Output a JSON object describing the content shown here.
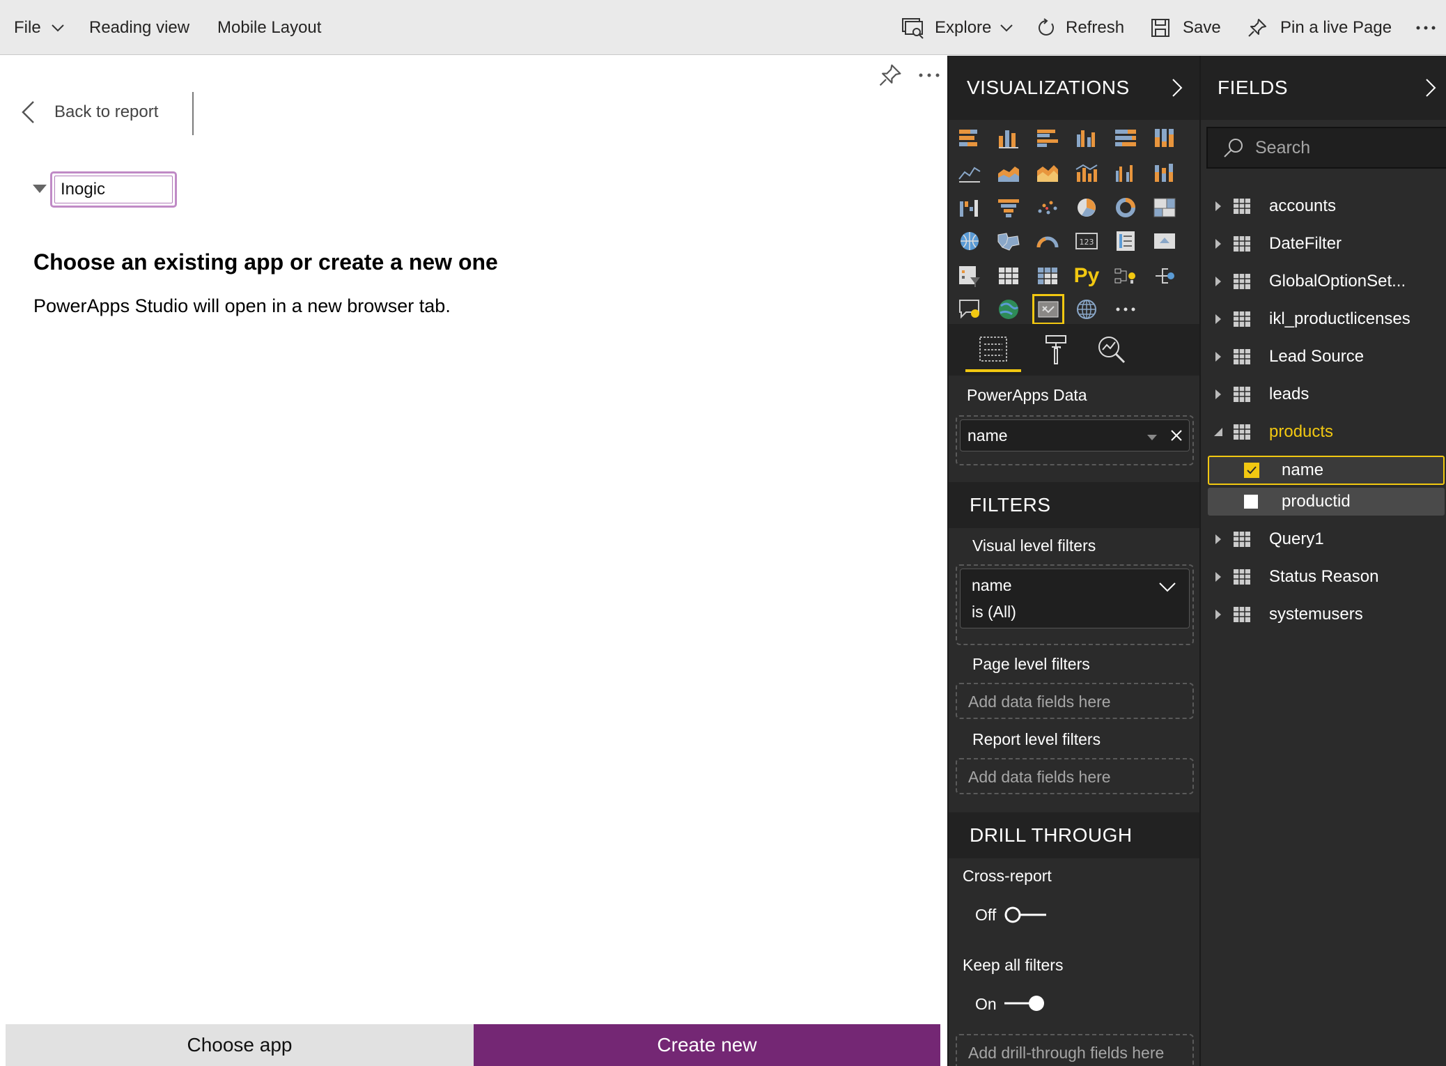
{
  "toolbar": {
    "file": "File",
    "reading_view": "Reading view",
    "mobile_layout": "Mobile Layout",
    "explore": "Explore",
    "refresh": "Refresh",
    "save": "Save",
    "pin": "Pin a live Page"
  },
  "canvas": {
    "back_label": "Back to report",
    "dropdown_value": "Inogic",
    "heading": "Choose an existing app or create a new one",
    "subtext": "PowerApps Studio will open in a new browser tab.",
    "choose_app": "Choose app",
    "create_new": "Create new",
    "create_color": "#742774"
  },
  "visualizations": {
    "title": "VISUALIZATIONS",
    "py_label": "Py",
    "data_label": "PowerApps Data",
    "data_field": "name",
    "filters": {
      "title": "FILTERS",
      "visual_level": "Visual level filters",
      "filter_field": "name",
      "filter_value": "is (All)",
      "page_level": "Page level filters",
      "page_placeholder": "Add data fields here",
      "report_level": "Report level filters",
      "report_placeholder": "Add data fields here"
    },
    "drill": {
      "title": "DRILL THROUGH",
      "cross_report": "Cross-report",
      "cross_state": "Off",
      "keep_filters": "Keep all filters",
      "keep_state": "On",
      "placeholder": "Add drill-through fields here"
    }
  },
  "fields": {
    "title": "FIELDS",
    "search_placeholder": "Search",
    "tables": [
      "accounts",
      "DateFilter",
      "GlobalOptionSet...",
      "ikl_productlicenses",
      "Lead Source",
      "leads",
      "products"
    ],
    "products_children": [
      {
        "name": "name",
        "checked": true
      },
      {
        "name": "productid",
        "checked": false
      }
    ],
    "tables_after": [
      "Query1",
      "Status Reason",
      "systemusers"
    ],
    "accent": "#f2c811"
  }
}
